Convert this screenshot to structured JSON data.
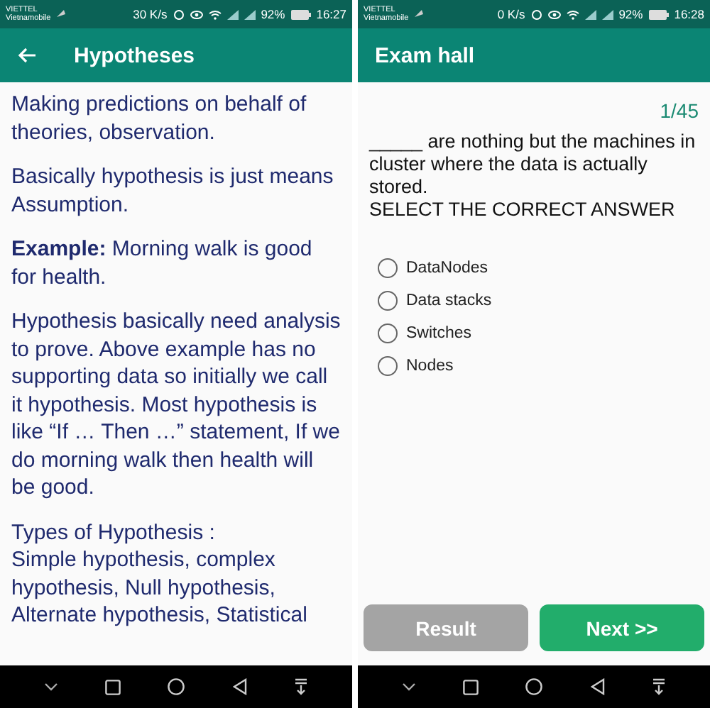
{
  "screens": [
    {
      "status_bar": {
        "carrier": "VIETTEL",
        "carrier_2": "Vietnamobile",
        "speed": "30 K/s",
        "battery": "92%",
        "time": "16:27"
      },
      "app_bar": {
        "title": "Hypotheses",
        "back": true
      },
      "paragraphs": [
        {
          "text": "Making predictions on behalf of theories, observation."
        },
        {
          "text": "Basically hypothesis is just means Assumption."
        },
        {
          "text": "**Example:** Morning walk is good for health."
        },
        {
          "text": "Hypothesis basically need analysis to prove. Above example has no supporting data so initially we call it hypothesis. Most hypothesis is like “If … Then …” statement, If we do morning walk then health will be good."
        },
        {
          "text": "Types of Hypothesis :\nSimple hypothesis, complex hypothesis, Null hypothesis, Alternate hypothesis, Statistical"
        }
      ]
    },
    {
      "status_bar": {
        "carrier": "VIETTEL",
        "carrier_2": "Vietnamobile",
        "speed": "0 K/s",
        "battery": "92%",
        "time": "16:28"
      },
      "app_bar": {
        "title": "Exam hall",
        "back": false
      },
      "counter": "1/45",
      "question": "_____ are nothing but the machines in cluster where the data is actually stored.",
      "instruction": "SELECT THE CORRECT ANSWER",
      "options": [
        {
          "label": "DataNodes",
          "selected": false
        },
        {
          "label": "Data stacks",
          "selected": false
        },
        {
          "label": "Switches",
          "selected": false
        },
        {
          "label": "Nodes",
          "selected": false
        }
      ],
      "buttons": [
        {
          "label": "Result",
          "disabled": true
        },
        {
          "label": "Next >>",
          "disabled": false
        }
      ]
    }
  ]
}
